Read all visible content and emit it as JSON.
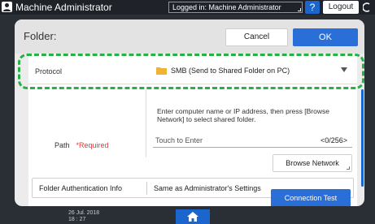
{
  "topbar": {
    "user_name": "Machine Administrator",
    "login_status": "Logged in: Machine Administrator",
    "help_label": "?",
    "logout_label": "Logout"
  },
  "dialog": {
    "title": "Folder:",
    "cancel_label": "Cancel",
    "ok_label": "OK"
  },
  "protocol": {
    "label": "Protocol",
    "value": "SMB (Send to Shared Folder on PC)"
  },
  "path": {
    "instruction": "Enter computer name or IP address, then press [Browse Network] to select shared folder.",
    "label": "Path",
    "required": "*Required",
    "placeholder": "Touch to Enter",
    "count": "<0/256>",
    "browse_label": "Browse Network"
  },
  "auth": {
    "label": "Folder Authentication Info",
    "value": "Same as Administrator's Settings"
  },
  "connection_test_label": "Connection Test",
  "footer": {
    "date": "26 Jul. 2018",
    "time": "18 : 27"
  },
  "colors": {
    "accent": "#2a6ed8",
    "highlight": "#27b046",
    "required": "#e03a3a"
  }
}
